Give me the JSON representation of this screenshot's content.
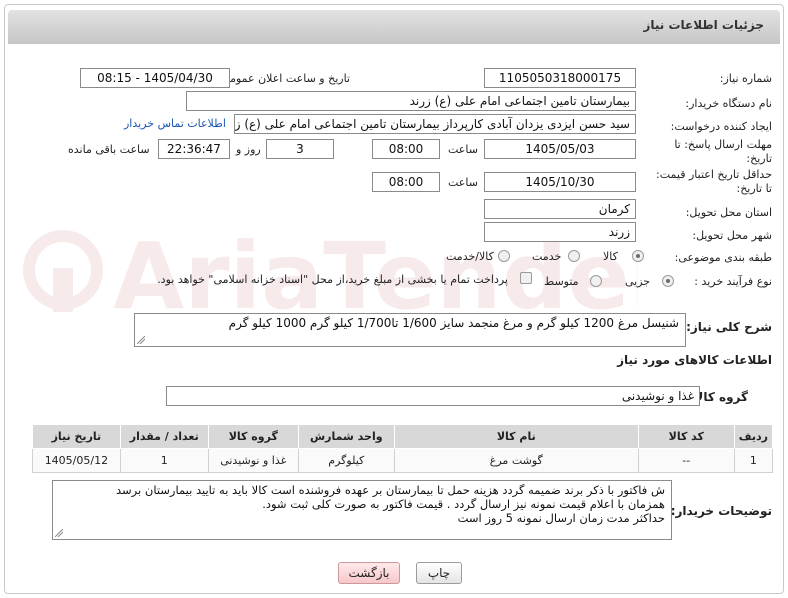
{
  "header": {
    "title": "جزئیات اطلاعات نیاز"
  },
  "fields": {
    "need_number_label": "شماره نیاز:",
    "need_number": "1105050318000175",
    "announce_label": "تاریخ و ساعت اعلان عمومی:",
    "announce_value": "1405/04/30 - 08:15",
    "buyer_org_label": "نام دستگاه خریدار:",
    "buyer_org": "بیمارستان تامین اجتماعی امام علی (ع) زرند",
    "creator_label": "ایجاد کننده درخواست:",
    "creator": "سید حسن ایزدی یزدان آبادی کارپرداز بیمارستان تامین اجتماعی امام علی (ع) ز",
    "contact_link": "اطلاعات تماس خریدار",
    "reply_deadline_label": "مهلت ارسال پاسخ: تا تاریخ:",
    "reply_date": "1405/05/03",
    "time_label": "ساعت",
    "reply_time": "08:00",
    "days": "3",
    "days_label": "روز و",
    "remaining_time": "22:36:47",
    "remaining_label": "ساعت باقی مانده",
    "price_validity_label": "حداقل تاریخ اعتبار قیمت: تا تاریخ:",
    "price_date": "1405/10/30",
    "price_time": "08:00",
    "province_label": "استان محل تحویل:",
    "province": "کرمان",
    "city_label": "شهر محل تحویل:",
    "city": "زرند",
    "category_label": "طبقه بندی موضوعی:",
    "category_options": [
      "کالا",
      "خدمت",
      "کالا/خدمت"
    ],
    "process_label": "نوع فرآیند خرید :",
    "process_options": [
      "جزیی",
      "متوسط"
    ],
    "payment_note": "پرداخت تمام یا بخشی از مبلغ خرید،از محل \"اسناد خزانه اسلامی\" خواهد بود.",
    "summary_label": "شرح کلی نیاز:",
    "summary": "شنیسل مرغ 1200 کیلو گرم     و     مرغ منجمد سایز 1/600 تا1/700 کیلو گرم   1000 کیلو گرم",
    "goods_info_title": "اطلاعات کالاهای مورد نیاز",
    "goods_group_label": "گروه کالا:",
    "goods_group": "غذا و نوشیدنی"
  },
  "table": {
    "headers": [
      "ردیف",
      "کد کالا",
      "نام کالا",
      "واحد شمارش",
      "گروه کالا",
      "تعداد / مقدار",
      "تاریخ نیاز"
    ],
    "rows": [
      [
        "1",
        "--",
        "گوشت مرغ",
        "کیلوگرم",
        "غذا و نوشیدنی",
        "1",
        "1405/05/12"
      ]
    ]
  },
  "buyer_notes_label": "توضیحات خریدار:",
  "buyer_notes": [
    "ش فاکتور با ذکر برند ضمیمه گردد هزینه حمل تا بیمارستان بر عهده فروشنده است کالا باید به تایید بیمارستان برسد",
    "همزمان با اعلام قیمت نمونه نیز ارسال گردد . قیمت فاکتور به صورت کلی ثبت شود.",
    "حداکثر مدت زمان ارسال نمونه 5 روز است"
  ],
  "buttons": {
    "print": "چاپ",
    "back": "بازگشت"
  },
  "watermark": "AriaTender.net",
  "colors": {
    "header_bg": "#d0d0d0",
    "link": "#1a55b3",
    "back_button": "#f7c7cb"
  }
}
